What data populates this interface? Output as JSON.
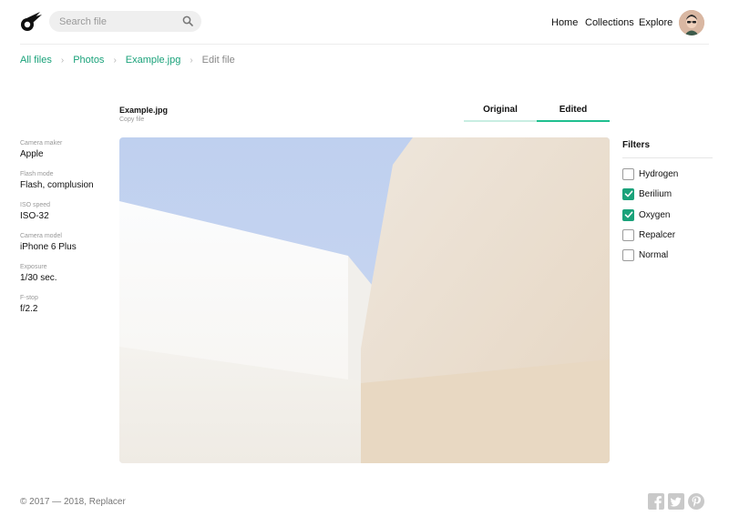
{
  "header": {
    "search_placeholder": "Search file",
    "nav": [
      "Home",
      "Collections",
      "Explore"
    ]
  },
  "breadcrumb": {
    "items": [
      "All files",
      "Photos",
      "Example.jpg"
    ],
    "current": "Edit file"
  },
  "file": {
    "name": "Example.jpg",
    "copy_label": "Copy file"
  },
  "tabs": {
    "items": [
      "Original",
      "Edited"
    ],
    "active": "Edited"
  },
  "metadata": [
    {
      "label": "Camera maker",
      "value": "Apple"
    },
    {
      "label": "Flash mode",
      "value": "Flash, complusion"
    },
    {
      "label": "ISO speed",
      "value": "ISO-32"
    },
    {
      "label": "Camera model",
      "value": "iPhone 6 Plus"
    },
    {
      "label": "Exposure",
      "value": "1/30 sec."
    },
    {
      "label": "F-stop",
      "value": "f/2.2"
    }
  ],
  "filters": {
    "title": "Filters",
    "items": [
      {
        "label": "Hydrogen",
        "checked": false
      },
      {
        "label": "Berilium",
        "checked": true
      },
      {
        "label": "Oxygen",
        "checked": true
      },
      {
        "label": "Repalcer",
        "checked": false
      },
      {
        "label": "Normal",
        "checked": false
      }
    ]
  },
  "footer": {
    "copyright": "© 2017 — 2018, Replacer",
    "social_icons": [
      "facebook-icon",
      "twitter-icon",
      "pinterest-icon"
    ]
  },
  "colors": {
    "accent": "#1aa27a",
    "tab_active": "#1fbf8f",
    "tab_inactive": "#c8eee2"
  },
  "icons": [
    "logo-comet-icon",
    "search-icon",
    "chevron-right-icon",
    "checkmark-icon"
  ]
}
